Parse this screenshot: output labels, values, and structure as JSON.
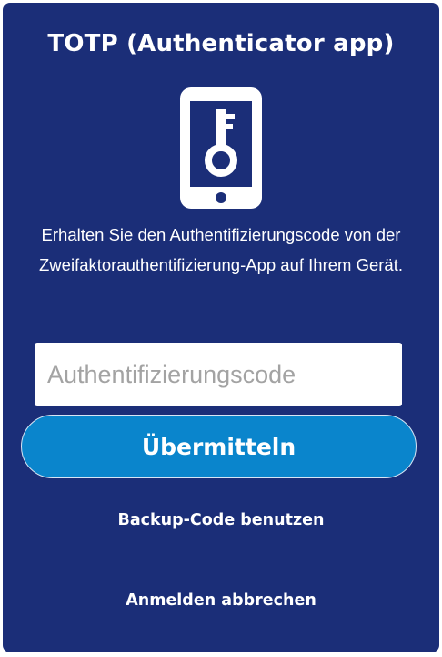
{
  "title": "TOTP (Authenticator app)",
  "icon": "phone-key-icon",
  "description": "Erhalten Sie den Authentifizierungscode von der Zweifaktorauthentifizierung-App auf Ihrem Gerät.",
  "code_input": {
    "placeholder": "Authentifizierungscode",
    "value": ""
  },
  "submit_label": "Übermitteln",
  "backup_link": "Backup-Code benutzen",
  "cancel_link": "Anmelden abbrechen",
  "colors": {
    "card_background": "#1b2e78",
    "button_background": "#0a85cc",
    "text": "#ffffff"
  }
}
